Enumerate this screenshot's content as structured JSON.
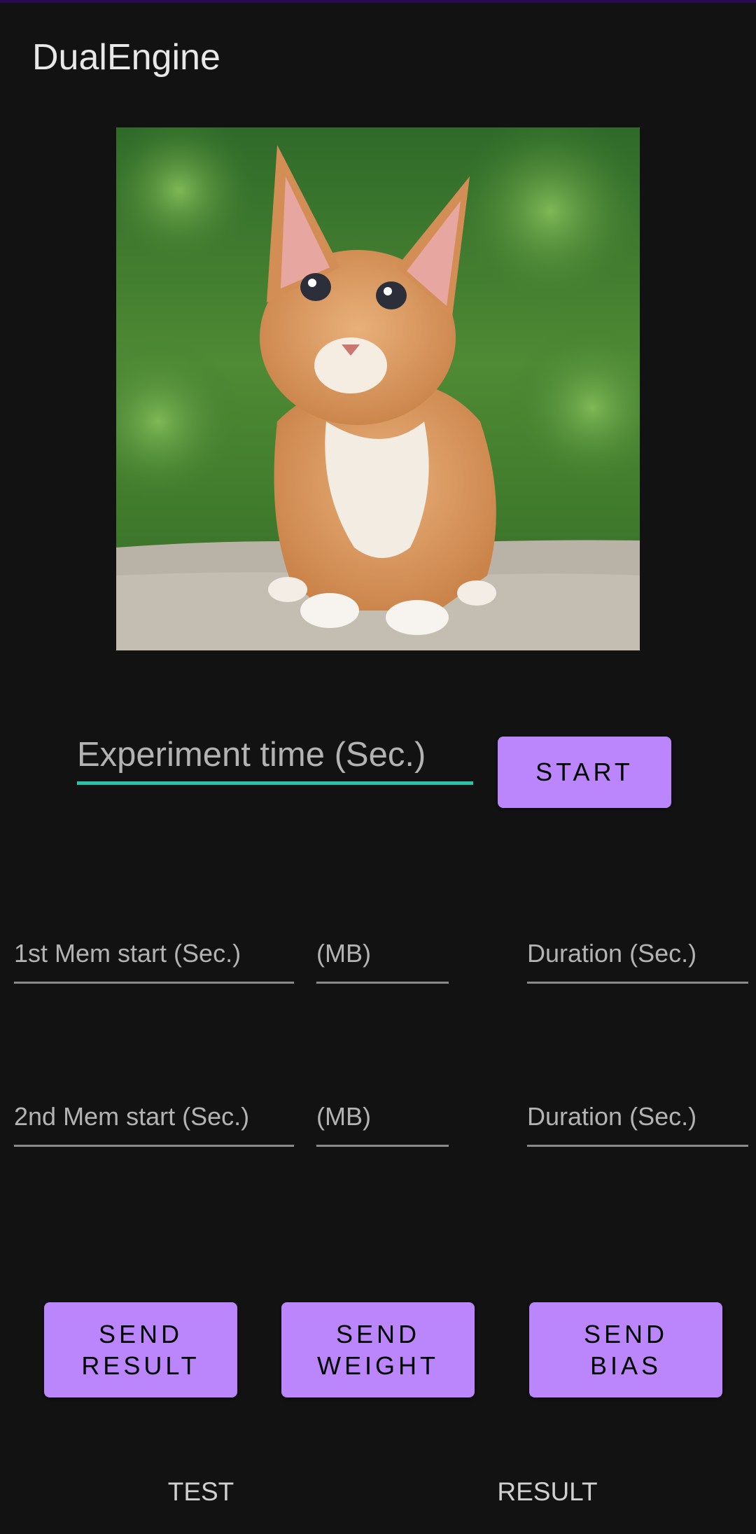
{
  "app": {
    "title": "DualEngine"
  },
  "image": {
    "subject": "orange-kitten-photo"
  },
  "experiment": {
    "time_placeholder": "Experiment time (Sec.)",
    "start_label": "START"
  },
  "memory": {
    "row1": {
      "start_placeholder": "1st Mem start (Sec.)",
      "mb_placeholder": "(MB)",
      "duration_placeholder": "Duration (Sec.)"
    },
    "row2": {
      "start_placeholder": "2nd Mem start (Sec.)",
      "mb_placeholder": "(MB)",
      "duration_placeholder": "Duration (Sec.)"
    }
  },
  "actions": {
    "send_result": "SEND\nRESULT",
    "send_weight": "SEND\nWEIGHT",
    "send_bias": "SEND\nBIAS"
  },
  "tabs": {
    "test": "TEST",
    "result": "RESULT"
  },
  "colors": {
    "background": "#121212",
    "accent_button": "#bb86fc",
    "focused_underline": "#2bc2a9"
  }
}
